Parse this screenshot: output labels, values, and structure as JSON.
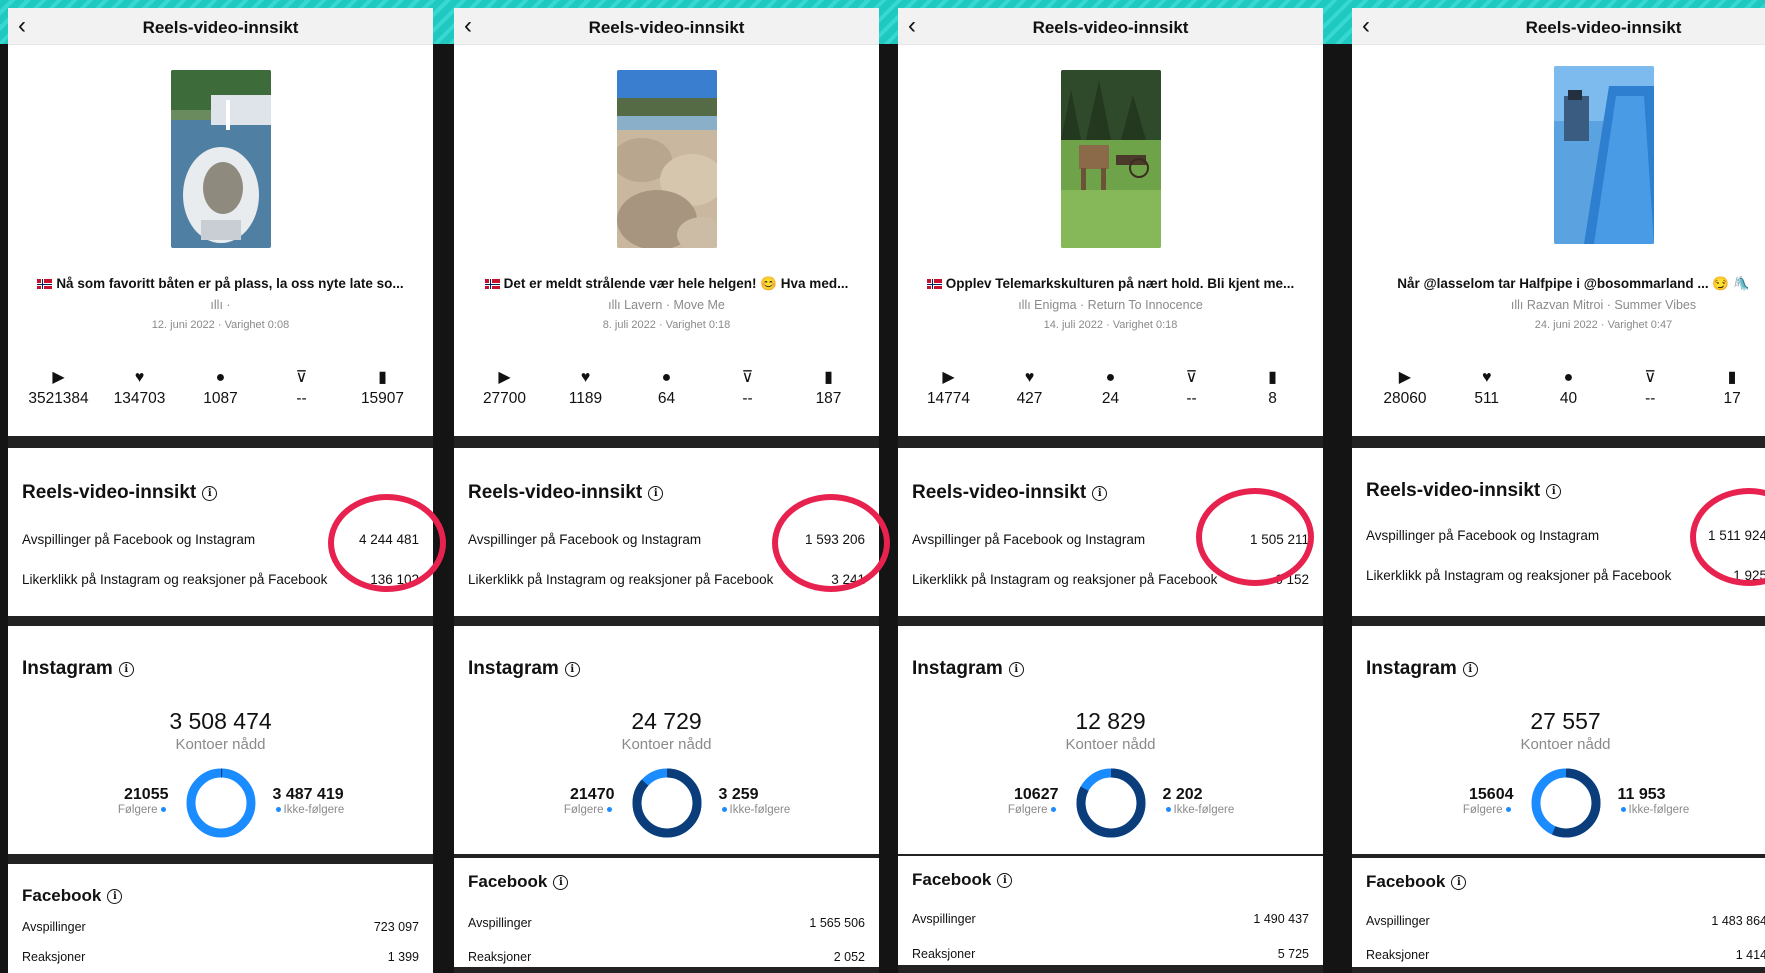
{
  "panels": [
    {
      "nav_title": "Reels-video-innsikt",
      "caption": "Nå som favoritt båten er på plass, la oss nyte late so...",
      "audio": "",
      "date": "12. juni 2022 · Varighet 0:08",
      "stats": [
        "3521384",
        "134703",
        "1087",
        "--",
        "15907"
      ],
      "reels_title": "Reels-video-innsikt",
      "plays_label": "Avspillinger på Facebook og Instagram",
      "plays_value": "4 244 481",
      "likes_label": "Likerklikk på Instagram og reaksjoner på Facebook",
      "likes_value": "136 102",
      "ig_title": "Instagram",
      "ig_total": "3 508 474",
      "ig_sub": "Kontoer nådd",
      "followers": "21055",
      "followers_label": "Følgere",
      "non_followers": "3 487 419",
      "non_followers_label": "Ikke-følgere",
      "followers_share": 0.006,
      "fb_title": "Facebook",
      "fb_rows": [
        {
          "label": "Avspillinger",
          "value": "723 097"
        },
        {
          "label": "Reaksjoner",
          "value": "1 399"
        }
      ]
    },
    {
      "nav_title": "Reels-video-innsikt",
      "caption": "Det er meldt strålende vær hele helgen! 😊 Hva med...",
      "audio": "Lavern · Move Me",
      "date": "8. juli 2022 · Varighet 0:18",
      "stats": [
        "27700",
        "1189",
        "64",
        "--",
        "187"
      ],
      "reels_title": "Reels-video-innsikt",
      "plays_label": "Avspillinger på Facebook og Instagram",
      "plays_value": "1 593 206",
      "likes_label": "Likerklikk på Instagram og reaksjoner på Facebook",
      "likes_value": "3 241",
      "ig_title": "Instagram",
      "ig_total": "24 729",
      "ig_sub": "Kontoer nådd",
      "followers": "21470",
      "followers_label": "Følgere",
      "non_followers": "3 259",
      "non_followers_label": "Ikke-følgere",
      "followers_share": 0.868,
      "fb_title": "Facebook",
      "fb_rows": [
        {
          "label": "Avspillinger",
          "value": "1 565 506"
        },
        {
          "label": "Reaksjoner",
          "value": "2 052"
        }
      ]
    },
    {
      "nav_title": "Reels-video-innsikt",
      "caption": "Opplev Telemarkskulturen på nært hold. Bli kjent me...",
      "audio": "Enigma · Return To Innocence",
      "date": "14. juli 2022 · Varighet 0:18",
      "stats": [
        "14774",
        "427",
        "24",
        "--",
        "8"
      ],
      "reels_title": "Reels-video-innsikt",
      "plays_label": "Avspillinger på Facebook og Instagram",
      "plays_value": "1 505 211",
      "likes_label": "Likerklikk på Instagram og reaksjoner på Facebook",
      "likes_value": "6 152",
      "ig_title": "Instagram",
      "ig_total": "12 829",
      "ig_sub": "Kontoer nådd",
      "followers": "10627",
      "followers_label": "Følgere",
      "non_followers": "2 202",
      "non_followers_label": "Ikke-følgere",
      "followers_share": 0.828,
      "fb_title": "Facebook",
      "fb_rows": [
        {
          "label": "Avspillinger",
          "value": "1 490 437"
        },
        {
          "label": "Reaksjoner",
          "value": "5 725"
        }
      ]
    },
    {
      "nav_title": "Reels-video-innsikt",
      "caption": "Når @lasselom tar Halfpipe i @bosommarland ... 😏 🛝",
      "audio": "Razvan Mitroi · Summer Vibes",
      "date": "24. juni 2022 · Varighet 0:47",
      "stats": [
        "28060",
        "511",
        "40",
        "--",
        "17"
      ],
      "reels_title": "Reels-video-innsikt",
      "plays_label": "Avspillinger på Facebook og Instagram",
      "plays_value": "1 511 924",
      "likes_label": "Likerklikk på Instagram og reaksjoner på Facebook",
      "likes_value": "1 925",
      "ig_title": "Instagram",
      "ig_total": "27 557",
      "ig_sub": "Kontoer nådd",
      "followers": "15604",
      "followers_label": "Følgere",
      "non_followers": "11 953",
      "non_followers_label": "Ikke-følgere",
      "followers_share": 0.566,
      "fb_title": "Facebook",
      "fb_rows": [
        {
          "label": "Avspillinger",
          "value": "1 483 864"
        },
        {
          "label": "Reaksjoner",
          "value": "1 414"
        }
      ]
    }
  ],
  "stat_icons": [
    "play-icon",
    "heart-icon",
    "comment-icon",
    "share-icon",
    "bookmark-icon"
  ],
  "colors": {
    "highlight_ring": "#e8224f",
    "followers": "#0b3d7a",
    "non_followers": "#1a8cff",
    "background_stripe": "#1fc9c1"
  }
}
